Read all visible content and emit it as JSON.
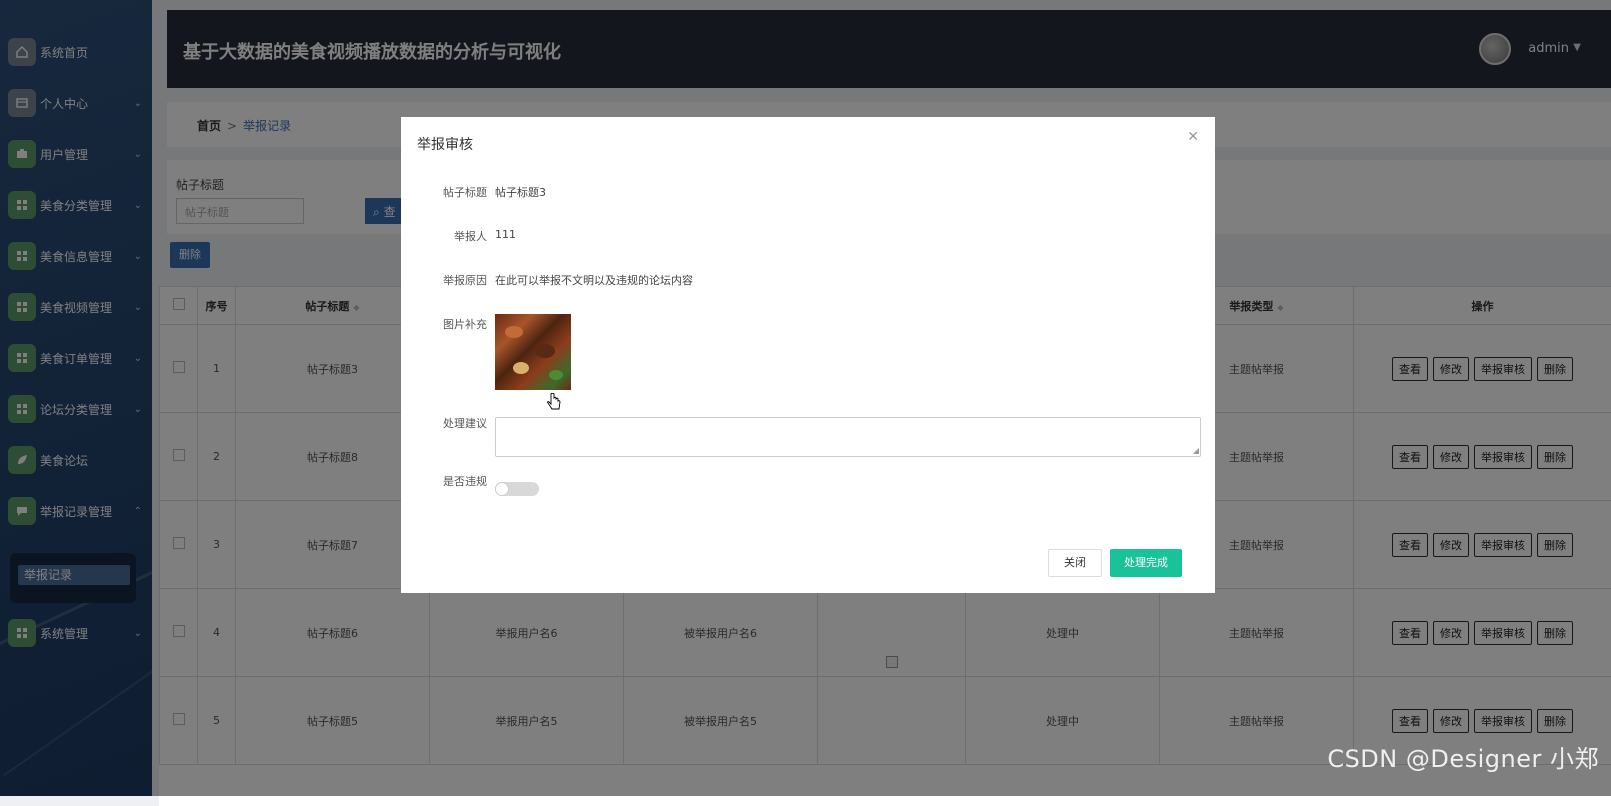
{
  "app": {
    "title": "基于大数据的美食视频播放数据的分析与可视化",
    "user": "admin"
  },
  "sidebar": {
    "items": [
      {
        "label": "系统首页",
        "icon": "home-icon"
      },
      {
        "label": "个人中心",
        "icon": "user-card-icon"
      },
      {
        "label": "用户管理",
        "icon": "users-icon"
      },
      {
        "label": "美食分类管理",
        "icon": "grid-icon"
      },
      {
        "label": "美食信息管理",
        "icon": "grid-icon"
      },
      {
        "label": "美食视频管理",
        "icon": "grid-icon"
      },
      {
        "label": "美食订单管理",
        "icon": "grid-icon"
      },
      {
        "label": "论坛分类管理",
        "icon": "grid-icon"
      },
      {
        "label": "美食论坛",
        "icon": "leaf-icon"
      },
      {
        "label": "举报记录管理",
        "icon": "chat-icon"
      },
      {
        "label": "系统管理",
        "icon": "grid-icon"
      }
    ],
    "submenu": {
      "label": "举报记录"
    }
  },
  "breadcrumb": {
    "home": "首页",
    "separator": ">",
    "current": "举报记录"
  },
  "search": {
    "label": "帖子标题",
    "placeholder": "帖子标题",
    "button": "查"
  },
  "toolbar": {
    "delete": "删除"
  },
  "table": {
    "headers": [
      "序号",
      "帖子标题",
      "举报类型",
      "操作"
    ],
    "rows": [
      {
        "index": "1",
        "title": "帖子标题3",
        "reporter": "",
        "reported": "",
        "status": "",
        "type": "主题帖举报"
      },
      {
        "index": "2",
        "title": "帖子标题8",
        "reporter": "",
        "reported": "",
        "status": "",
        "type": "主题帖举报"
      },
      {
        "index": "3",
        "title": "帖子标题7",
        "reporter": "",
        "reported": "",
        "status": "",
        "type": "主题帖举报"
      },
      {
        "index": "4",
        "title": "帖子标题6",
        "reporter": "举报用户名6",
        "reported": "被举报用户名6",
        "status": "处理中",
        "type": "主题帖举报"
      },
      {
        "index": "5",
        "title": "帖子标题5",
        "reporter": "举报用户名5",
        "reported": "被举报用户名5",
        "status": "处理中",
        "type": "主题帖举报"
      }
    ],
    "actions": {
      "view": "查看",
      "edit": "修改",
      "review": "举报审核",
      "delete": "删除"
    }
  },
  "modal": {
    "title": "举报审核",
    "fields": {
      "post_title_label": "帖子标题",
      "post_title_value": "帖子标题3",
      "reporter_label": "举报人",
      "reporter_value": "111",
      "reason_label": "举报原因",
      "reason_value": "在此可以举报不文明以及违规的论坛内容",
      "image_label": "图片补充",
      "advice_label": "处理建议",
      "advice_value": "",
      "violation_label": "是否违规",
      "violation_on": false
    },
    "buttons": {
      "close": "关闭",
      "done": "处理完成"
    }
  },
  "colors": {
    "accent": "#19c298",
    "primary": "#3a6fb5",
    "header_bg": "#262d3a"
  },
  "watermark": "CSDN @Designer 小郑"
}
